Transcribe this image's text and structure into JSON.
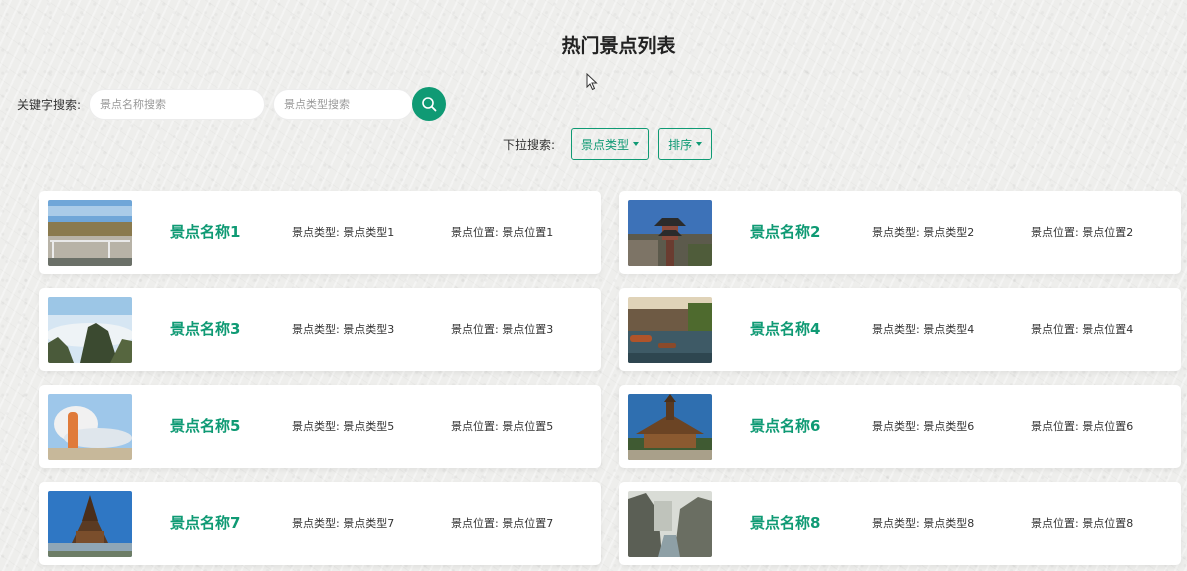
{
  "page": {
    "title": "热门景点列表"
  },
  "search": {
    "keyword_label": "关键字搜索:",
    "name_placeholder": "景点名称搜索",
    "type_placeholder": "景点类型搜索",
    "button_icon": "search-icon"
  },
  "dropdowns": {
    "label": "下拉搜索:",
    "type_label": "景点类型",
    "sort_label": "排序"
  },
  "colors": {
    "accent": "#0f9a74"
  },
  "field_labels": {
    "type": "景点类型:",
    "location": "景点位置:"
  },
  "spots": [
    {
      "name": "景点名称1",
      "type": "景点类型1",
      "location": "景点位置1"
    },
    {
      "name": "景点名称2",
      "type": "景点类型2",
      "location": "景点位置2"
    },
    {
      "name": "景点名称3",
      "type": "景点类型3",
      "location": "景点位置3"
    },
    {
      "name": "景点名称4",
      "type": "景点类型4",
      "location": "景点位置4"
    },
    {
      "name": "景点名称5",
      "type": "景点类型5",
      "location": "景点位置5"
    },
    {
      "name": "景点名称6",
      "type": "景点类型6",
      "location": "景点位置6"
    },
    {
      "name": "景点名称7",
      "type": "景点类型7",
      "location": "景点位置7"
    },
    {
      "name": "景点名称8",
      "type": "景点类型8",
      "location": "景点位置8"
    }
  ]
}
